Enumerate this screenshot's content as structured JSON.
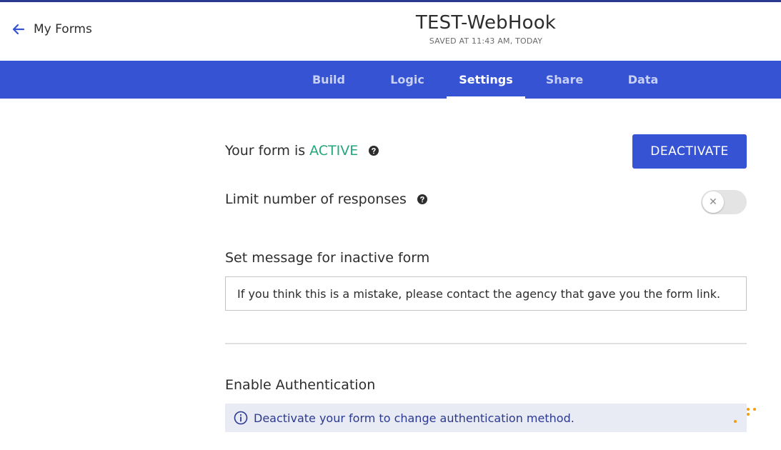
{
  "header": {
    "back_label": "My Forms",
    "form_title": "TEST-WebHook",
    "saved_status": "SAVED AT 11:43 AM, TODAY"
  },
  "tabs": [
    {
      "label": "Build",
      "active": false
    },
    {
      "label": "Logic",
      "active": false
    },
    {
      "label": "Settings",
      "active": true
    },
    {
      "label": "Share",
      "active": false
    },
    {
      "label": "Data",
      "active": false
    }
  ],
  "settings": {
    "status_prefix": "Your form is",
    "status_value": "ACTIVE",
    "deactivate_label": "DEACTIVATE",
    "limit_label": "Limit number of responses",
    "limit_enabled": false,
    "inactive_message_label": "Set message for inactive form",
    "inactive_message_value": "If you think this is a mistake, please contact the agency that gave you the form link.",
    "auth_label": "Enable Authentication",
    "auth_info": "Deactivate your form to change authentication method."
  },
  "colors": {
    "brand_blue": "#3653d4",
    "active_green": "#22a77d",
    "info_bg": "#e8eaf4",
    "info_text": "#2b3a8f"
  },
  "icons": [
    "back-arrow-icon",
    "help-circle-icon",
    "close-icon",
    "info-circle-icon",
    "loading-dots-icon"
  ]
}
